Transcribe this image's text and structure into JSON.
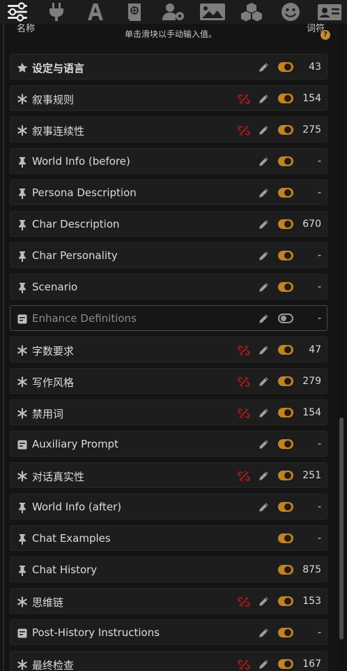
{
  "toolbar": {
    "icons": [
      "sliders-icon",
      "plug-icon",
      "font-icon",
      "book-icon",
      "user-gear-icon",
      "image-icon",
      "cubes-icon",
      "smile-icon",
      "id-card-icon"
    ]
  },
  "header": {
    "name_col": "名称",
    "tokens_col": "词符",
    "hint": "单击滑块以手动输入值。",
    "help_glyph": "?"
  },
  "colors": {
    "accent": "#c0832a",
    "link_red": "#a31c1c",
    "row_bg": "#1d1d1d"
  },
  "prompts": [
    {
      "icon": "star-icon",
      "name": "设定与语言",
      "bold": true,
      "link": false,
      "pen": true,
      "enabled": true,
      "tokens": "43"
    },
    {
      "icon": "asterisk-icon",
      "name": "叙事规则",
      "bold": false,
      "link": true,
      "pen": true,
      "enabled": true,
      "tokens": "154"
    },
    {
      "icon": "asterisk-icon",
      "name": "叙事连续性",
      "bold": false,
      "link": true,
      "pen": true,
      "enabled": true,
      "tokens": "275"
    },
    {
      "icon": "pin-icon",
      "name": "World Info (before)",
      "bold": false,
      "link": false,
      "pen": true,
      "enabled": true,
      "tokens": "-"
    },
    {
      "icon": "pin-icon",
      "name": "Persona Description",
      "bold": false,
      "link": false,
      "pen": true,
      "enabled": true,
      "tokens": "-"
    },
    {
      "icon": "pin-icon",
      "name": "Char Description",
      "bold": false,
      "link": false,
      "pen": true,
      "enabled": true,
      "tokens": "670"
    },
    {
      "icon": "pin-icon",
      "name": "Char Personality",
      "bold": false,
      "link": false,
      "pen": true,
      "enabled": true,
      "tokens": "-"
    },
    {
      "icon": "pin-icon",
      "name": "Scenario",
      "bold": false,
      "link": false,
      "pen": true,
      "enabled": true,
      "tokens": "-"
    },
    {
      "icon": "note-icon",
      "name": "Enhance Definitions",
      "bold": false,
      "link": false,
      "pen": true,
      "enabled": false,
      "tokens": "-"
    },
    {
      "icon": "asterisk-icon",
      "name": "字数要求",
      "bold": false,
      "link": true,
      "pen": true,
      "enabled": true,
      "tokens": "47"
    },
    {
      "icon": "asterisk-icon",
      "name": "写作风格",
      "bold": false,
      "link": true,
      "pen": true,
      "enabled": true,
      "tokens": "279"
    },
    {
      "icon": "asterisk-icon",
      "name": "禁用词",
      "bold": false,
      "link": true,
      "pen": true,
      "enabled": true,
      "tokens": "154"
    },
    {
      "icon": "note-icon",
      "name": "Auxiliary Prompt",
      "bold": false,
      "link": false,
      "pen": true,
      "enabled": true,
      "tokens": "-"
    },
    {
      "icon": "asterisk-icon",
      "name": "对话真实性",
      "bold": false,
      "link": true,
      "pen": true,
      "enabled": true,
      "tokens": "251"
    },
    {
      "icon": "pin-icon",
      "name": "World Info (after)",
      "bold": false,
      "link": false,
      "pen": true,
      "enabled": true,
      "tokens": "-"
    },
    {
      "icon": "pin-icon",
      "name": "Chat Examples",
      "bold": false,
      "link": false,
      "pen": false,
      "enabled": true,
      "tokens": "-"
    },
    {
      "icon": "pin-icon",
      "name": "Chat History",
      "bold": false,
      "link": false,
      "pen": false,
      "enabled": true,
      "tokens": "875"
    },
    {
      "icon": "asterisk-icon",
      "name": "思维链",
      "bold": false,
      "link": true,
      "pen": true,
      "enabled": true,
      "tokens": "153"
    },
    {
      "icon": "note-icon",
      "name": "Post-History Instructions",
      "bold": false,
      "link": false,
      "pen": true,
      "enabled": true,
      "tokens": "-"
    },
    {
      "icon": "asterisk-icon",
      "name": "最终检查",
      "bold": false,
      "link": true,
      "pen": true,
      "enabled": true,
      "tokens": "167"
    }
  ]
}
